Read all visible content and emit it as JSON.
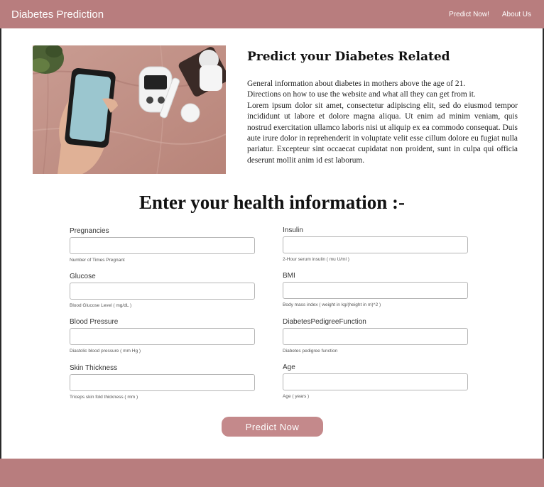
{
  "navbar": {
    "brand": "Diabetes Prediction",
    "links": [
      "Predict Now!",
      "About Us"
    ]
  },
  "hero": {
    "image_alt": "hand holding phone next to glucose meter",
    "title": "Predict your Diabetes Related",
    "lines": [
      "General information about diabetes in mothers above the age of 21.",
      "Directions on how to use the website and what all they can get from it."
    ],
    "lorem": "Lorem ipsum dolor sit amet, consectetur adipiscing elit, sed do eiusmod tempor incididunt ut labore et dolore magna aliqua. Ut enim ad minim veniam, quis nostrud exercitation ullamco laboris nisi ut aliquip ex ea commodo consequat. Duis aute irure dolor in reprehenderit in voluptate velit esse cillum dolore eu fugiat nulla pariatur. Excepteur sint occaecat cupidatat non proident, sunt in culpa qui officia deserunt mollit anim id est laborum."
  },
  "form": {
    "title": "Enter your health information :-",
    "left": [
      {
        "label": "Pregnancies",
        "value": "",
        "hint": "Number of Times Pregnant"
      },
      {
        "label": "Glucose",
        "value": "",
        "hint": "Blood Glucose Level ( mg/dL )"
      },
      {
        "label": "Blood Pressure",
        "value": "",
        "hint": "Diastolic blood pressure ( mm Hg )"
      },
      {
        "label": "Skin Thickness",
        "value": "",
        "hint": "Triceps skin fold thickness ( mm )"
      }
    ],
    "right": [
      {
        "label": "Insulin",
        "value": "",
        "hint": "2-Hour serum insulin ( mu U/ml )"
      },
      {
        "label": "BMI",
        "value": "",
        "hint": "Body mass index ( weight in kg/(height in m)^2 )"
      },
      {
        "label": "DiabetesPedigreeFunction",
        "value": "",
        "hint": "Diabetes pedigree function"
      },
      {
        "label": "Age",
        "value": "",
        "hint": "Age ( years )"
      }
    ],
    "submit_label": "Predict Now"
  },
  "colors": {
    "accent": "#b87d7e",
    "button": "#c4898b"
  }
}
